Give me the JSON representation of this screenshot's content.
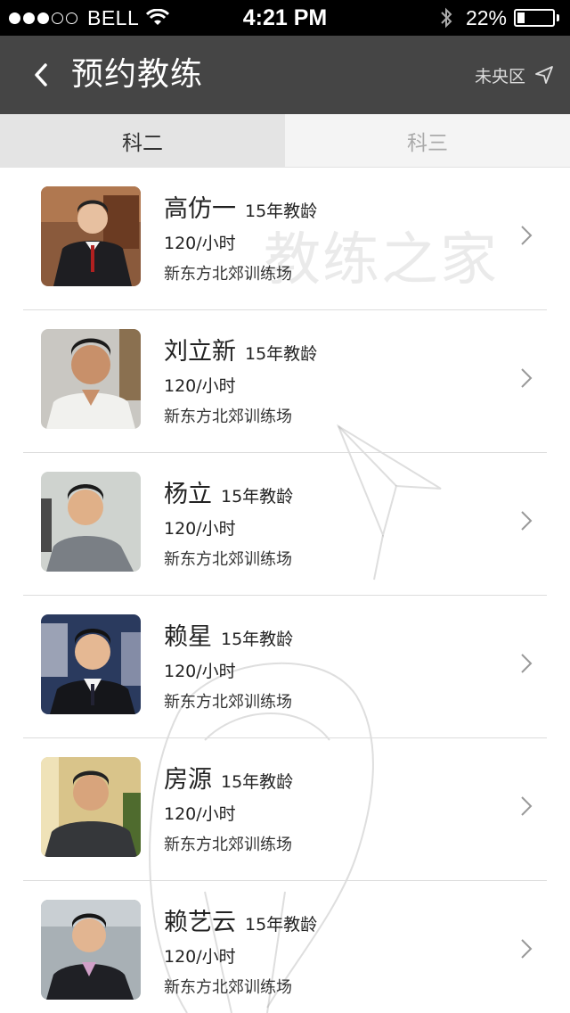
{
  "status": {
    "carrier": "BELL",
    "time": "4:21 PM",
    "battery": "22%",
    "battery_level": 0.22
  },
  "nav": {
    "title": "预约教练",
    "location": "未央区"
  },
  "tabs": [
    {
      "label": "科二",
      "active": true
    },
    {
      "label": "科三",
      "active": false
    }
  ],
  "coaches": [
    {
      "name": "高仿一",
      "experience": "15年教龄",
      "price": "120/小时",
      "place": "新东方北郊训练场"
    },
    {
      "name": "刘立新",
      "experience": "15年教龄",
      "price": "120/小时",
      "place": "新东方北郊训练场"
    },
    {
      "name": "杨立",
      "experience": "15年教龄",
      "price": "120/小时",
      "place": "新东方北郊训练场"
    },
    {
      "name": "赖星",
      "experience": "15年教龄",
      "price": "120/小时",
      "place": "新东方北郊训练场"
    },
    {
      "name": "房源",
      "experience": "15年教龄",
      "price": "120/小时",
      "place": "新东方北郊训练场"
    },
    {
      "name": "赖艺云",
      "experience": "15年教龄",
      "price": "120/小时",
      "place": "新东方北郊训练场"
    }
  ],
  "watermark": "教练之家",
  "colors": {
    "status_bar": "#000000",
    "nav_bar": "#454545",
    "tab_active": "#e4e4e4",
    "tab_inactive": "#f4f4f4"
  }
}
